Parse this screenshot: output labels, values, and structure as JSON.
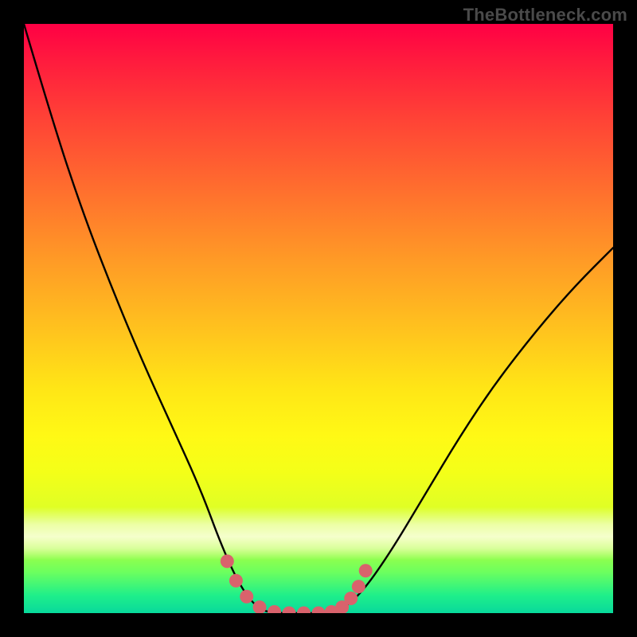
{
  "watermark": "TheBottleneck.com",
  "chart_data": {
    "type": "line",
    "title": "",
    "xlabel": "",
    "ylabel": "",
    "xlim": [
      0,
      1
    ],
    "ylim": [
      0,
      1
    ],
    "series": [
      {
        "name": "left-curve",
        "x": [
          0.0,
          0.05,
          0.1,
          0.15,
          0.2,
          0.25,
          0.3,
          0.337,
          0.37,
          0.4,
          0.43
        ],
        "y": [
          1.0,
          0.83,
          0.68,
          0.55,
          0.43,
          0.32,
          0.21,
          0.11,
          0.04,
          0.005,
          0.0
        ]
      },
      {
        "name": "floor",
        "x": [
          0.43,
          0.48,
          0.53
        ],
        "y": [
          0.0,
          0.0,
          0.0
        ]
      },
      {
        "name": "right-curve",
        "x": [
          0.53,
          0.57,
          0.62,
          0.68,
          0.74,
          0.8,
          0.87,
          0.935,
          1.0
        ],
        "y": [
          0.0,
          0.03,
          0.1,
          0.2,
          0.3,
          0.39,
          0.48,
          0.555,
          0.62
        ]
      },
      {
        "name": "highlight-dots",
        "type": "scatter",
        "x": [
          0.345,
          0.36,
          0.378,
          0.4,
          0.425,
          0.45,
          0.475,
          0.5,
          0.522,
          0.54,
          0.555,
          0.568,
          0.58
        ],
        "y": [
          0.088,
          0.055,
          0.028,
          0.01,
          0.002,
          0.0,
          0.0,
          0.0,
          0.002,
          0.01,
          0.025,
          0.045,
          0.072
        ]
      }
    ],
    "colors": {
      "curve_stroke": "#000000",
      "dot_fill": "#d9626c",
      "background_top": "#ff0044",
      "background_bottom": "#08d99c"
    }
  }
}
